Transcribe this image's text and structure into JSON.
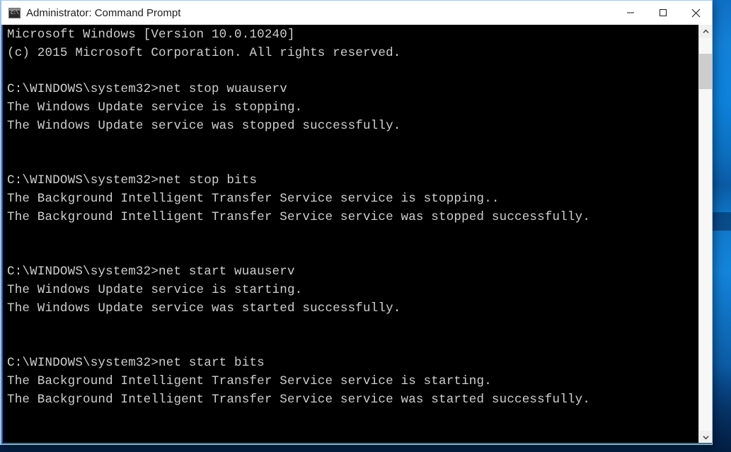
{
  "window": {
    "title": "Administrator: Command Prompt",
    "icon": "command-prompt-icon",
    "icon_glyph": "C:\\",
    "controls": {
      "minimize_label": "Minimize",
      "maximize_label": "Maximize",
      "close_label": "Close"
    }
  },
  "console": {
    "background_color": "#000000",
    "text_color": "#cccccc",
    "lines": [
      "Microsoft Windows [Version 10.0.10240]",
      "(c) 2015 Microsoft Corporation. All rights reserved.",
      "",
      "C:\\WINDOWS\\system32>net stop wuauserv",
      "The Windows Update service is stopping.",
      "The Windows Update service was stopped successfully.",
      "",
      "",
      "C:\\WINDOWS\\system32>net stop bits",
      "The Background Intelligent Transfer Service service is stopping..",
      "The Background Intelligent Transfer Service service was stopped successfully.",
      "",
      "",
      "C:\\WINDOWS\\system32>net start wuauserv",
      "The Windows Update service is starting.",
      "The Windows Update service was started successfully.",
      "",
      "",
      "C:\\WINDOWS\\system32>net start bits",
      "The Background Intelligent Transfer Service service is starting.",
      "The Background Intelligent Transfer Service service was started successfully.",
      "",
      ""
    ],
    "prompt": "C:\\WINDOWS\\system32>"
  },
  "scrollbar": {
    "up_arrow": "chevron-up-icon",
    "down_arrow": "chevron-down-icon",
    "thumb_position_pct": 4,
    "thumb_size_pct": 9
  },
  "desktop": {
    "wallpaper_accent": "#1281d8",
    "wallpaper_dark": "#08376e"
  }
}
